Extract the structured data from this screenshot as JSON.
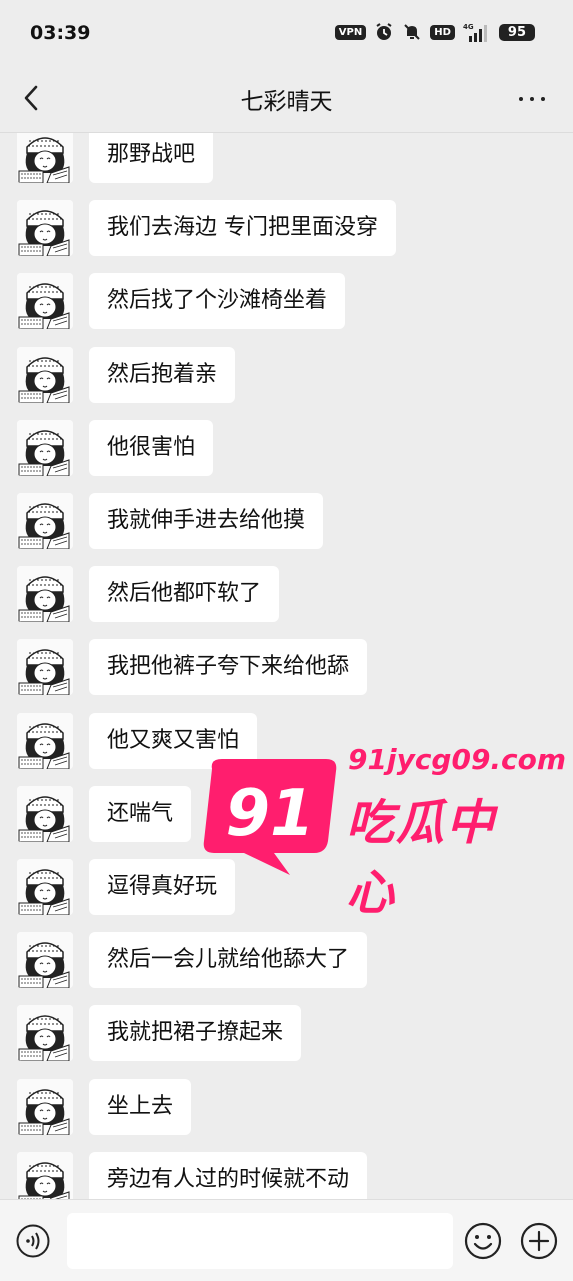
{
  "status": {
    "time": "03:39",
    "vpn": "VPN",
    "hd": "HD",
    "network": "4G",
    "battery": "95"
  },
  "header": {
    "title": "七彩晴天",
    "back_icon": "chevron-left-icon",
    "more_icon": "more-horizontal-icon"
  },
  "messages": [
    "那野战吧",
    "我们去海边 专门把里面没穿",
    "然后找了个沙滩椅坐着",
    "然后抱着亲",
    "他很害怕",
    "我就伸手进去给他摸",
    "然后他都吓软了",
    "我把他裤子夸下来给他舔",
    "他又爽又害怕",
    "还喘气",
    "逗得真好玩",
    "然后一会儿就给他舔大了",
    "我就把裙子撩起来",
    "坐上去",
    " 旁边有人过的时候就不动"
  ],
  "watermark": {
    "number": "91",
    "url": "91jycg09.com",
    "name": "吃瓜中心",
    "color": "#ff1e6e"
  },
  "input_bar": {
    "voice_icon": "voice-icon",
    "emoji_icon": "emoji-icon",
    "plus_icon": "plus-icon",
    "placeholder": ""
  }
}
